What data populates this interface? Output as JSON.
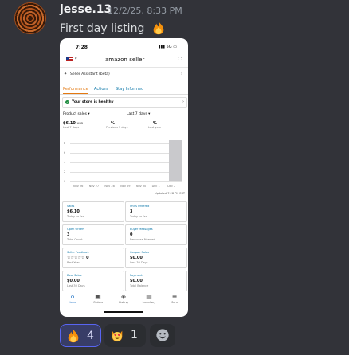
{
  "message": {
    "author": "jesse.13",
    "timestamp": "12/2/25, 8:33 PM",
    "text": "First day listing"
  },
  "phone": {
    "status_time": "7:28",
    "status_right": "5G",
    "brand_main": "amazon",
    "brand_sub": "seller",
    "assistant_label": "Seller Assistant (beta)",
    "tabs": [
      "Performance",
      "Actions",
      "Stay Informed"
    ],
    "health_text": "Your store is healthy",
    "selectors": [
      "Product sales",
      "Last 7 days"
    ],
    "metrics": [
      {
        "value": "$6.10",
        "unit": "USD",
        "sub": "Last 7 days"
      },
      {
        "value": "-- %",
        "sub": "Previous 7 days"
      },
      {
        "value": "-- %",
        "sub": "Last year"
      }
    ],
    "chart_y_labels": [
      "8",
      "6",
      "4",
      "2",
      "0"
    ],
    "chart_x_labels": [
      "Nov 26",
      "Nov 27",
      "Nov 28",
      "Nov 29",
      "Nov 30",
      "Dec 1",
      "Dec 2"
    ],
    "chart_values": [
      0,
      0,
      0,
      0,
      0,
      0,
      8.6
    ],
    "updated": "Updated 7:28 PM EST",
    "cards": [
      {
        "title": "Sales",
        "value": "$6.10",
        "sub": "Today so far"
      },
      {
        "title": "Units Ordered",
        "value": "3",
        "sub": "Today so far"
      },
      {
        "title": "Open Orders",
        "value": "3",
        "sub": "Total Count"
      },
      {
        "title": "Buyer Messages",
        "value": "0",
        "sub": "Response Needed"
      },
      {
        "title": "Seller Feedback",
        "value": "☆☆☆☆☆ 0",
        "sub": "Past Year"
      },
      {
        "title": "Coupon Sales",
        "value": "$0.00",
        "sub": "Last 30 Days"
      },
      {
        "title": "Deal Sales",
        "value": "$0.00",
        "sub": "Last 30 Days"
      },
      {
        "title": "Payments",
        "value": "$0.00",
        "sub": "Total Balance"
      }
    ],
    "nav": [
      {
        "label": "Home",
        "icon": "house-icon"
      },
      {
        "label": "Orders",
        "icon": "box-icon"
      },
      {
        "label": "Listing",
        "icon": "tag-icon"
      },
      {
        "label": "Inventory",
        "icon": "clipboard-icon"
      },
      {
        "label": "Menu",
        "icon": "hamburger-icon"
      }
    ]
  },
  "reactions": [
    {
      "emoji": "fire-emoji",
      "count": "4",
      "me": true
    },
    {
      "emoji": "heart-eyes-cat-emoji",
      "count": "1",
      "me": false
    }
  ],
  "colors": {
    "background": "#323339",
    "accent": "#5865f2",
    "amazon_orange": "#e47911"
  }
}
